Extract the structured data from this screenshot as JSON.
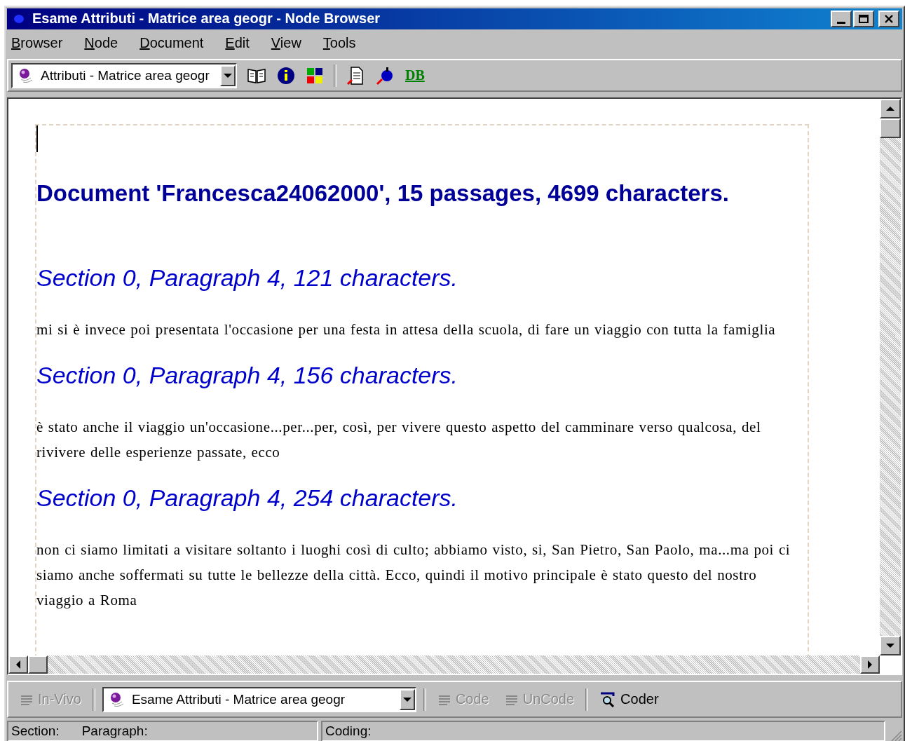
{
  "window": {
    "title": "Esame Attributi - Matrice area geogr - Node Browser"
  },
  "menu": [
    "Browser",
    "Node",
    "Document",
    "Edit",
    "View",
    "Tools"
  ],
  "toolbar": {
    "node_combo": "Attributi - Matrice area geogr",
    "db_button": "DB"
  },
  "document": {
    "heading": "Document 'Francesca24062000',  15 passages, 4699 characters.",
    "passages": [
      {
        "heading": "Section 0, Paragraph 4, 121 characters.",
        "text": "mi si è invece poi presentata l'occasione per una festa in attesa della scuola, di fare un viaggio con tutta la famiglia"
      },
      {
        "heading": "Section 0, Paragraph 4, 156 characters.",
        "text": "è stato anche il viaggio un'occasione...per...per, così, per vivere questo aspetto del camminare verso qualcosa, del rivivere delle esperienze passate, ecco"
      },
      {
        "heading": "Section 0, Paragraph 4, 254 characters.",
        "text": "non ci siamo limitati a visitare soltanto i luoghi così di culto; abbiamo visto, si, San Pietro, San Paolo, ma...ma poi ci siamo anche soffermati su tutte le bellezze della città. Ecco, quindi il motivo principale è stato questo del nostro viaggio a Roma"
      }
    ]
  },
  "coding_bar": [
    {
      "kind": "button",
      "label": "In-Vivo",
      "disabled": true
    },
    {
      "kind": "combo",
      "value": "Esame Attributi - Matrice area geogr"
    },
    {
      "kind": "button",
      "label": "Code",
      "disabled": true
    },
    {
      "kind": "button",
      "label": "UnCode",
      "disabled": true
    },
    {
      "kind": "coder",
      "label": "Coder",
      "disabled": false
    }
  ],
  "status_bar": [
    "Section:",
    "Paragraph:",
    "Coding:"
  ]
}
